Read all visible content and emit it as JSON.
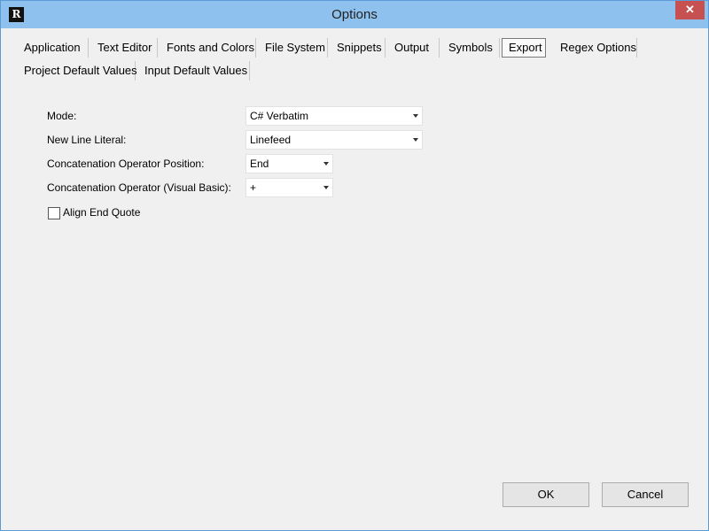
{
  "window": {
    "title": "Options",
    "icon_glyph": "R",
    "close_glyph": "✕"
  },
  "tabs": {
    "row1": [
      "Application",
      "Text Editor",
      "Fonts and Colors",
      "File System",
      "Snippets",
      "Output",
      "Symbols",
      "Export",
      "Regex Options"
    ],
    "row2": [
      "Project Default Values",
      "Input Default Values"
    ],
    "active": "Export"
  },
  "form": {
    "mode": {
      "label": "Mode:",
      "value": "C# Verbatim"
    },
    "newline": {
      "label": "New Line Literal:",
      "value": "Linefeed"
    },
    "concat_pos": {
      "label": "Concatenation Operator Position:",
      "value": "End"
    },
    "concat_vb": {
      "label": "Concatenation Operator (Visual Basic):",
      "value": "+"
    },
    "align": {
      "label": "Align End Quote",
      "checked": false
    }
  },
  "buttons": {
    "ok": "OK",
    "cancel": "Cancel"
  },
  "colors": {
    "titlebar": "#8ec1ee",
    "close": "#c75050",
    "window_border": "#5b9bd5"
  }
}
